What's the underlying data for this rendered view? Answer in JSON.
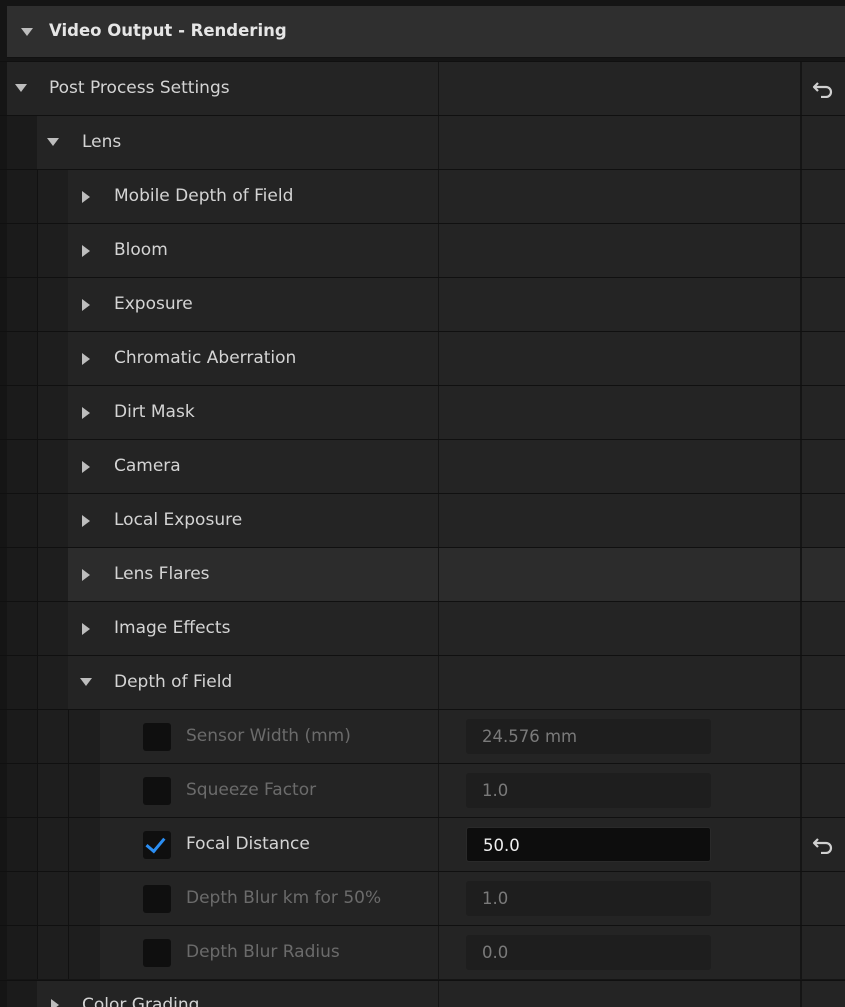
{
  "category": {
    "title": "Video Output - Rendering"
  },
  "post_process": {
    "label": "Post Process Settings",
    "reset_icon": "reset-arrow-icon"
  },
  "lens": {
    "label": "Lens"
  },
  "lens_sections": [
    {
      "label": "Mobile Depth of Field"
    },
    {
      "label": "Bloom"
    },
    {
      "label": "Exposure"
    },
    {
      "label": "Chromatic Aberration"
    },
    {
      "label": "Dirt Mask"
    },
    {
      "label": "Camera"
    },
    {
      "label": "Local Exposure"
    },
    {
      "label": "Lens Flares"
    },
    {
      "label": "Image Effects"
    }
  ],
  "dof": {
    "label": "Depth of Field",
    "properties": [
      {
        "label": "Sensor Width (mm)",
        "value": "24.576 mm",
        "checked": false
      },
      {
        "label": "Squeeze Factor",
        "value": "1.0",
        "checked": false
      },
      {
        "label": "Focal Distance",
        "value": "50.0",
        "checked": true
      },
      {
        "label": "Depth Blur km for 50%",
        "value": "1.0",
        "checked": false
      },
      {
        "label": "Depth Blur Radius",
        "value": "0.0",
        "checked": false
      }
    ]
  },
  "color_grading": {
    "label": "Color Grading"
  },
  "colors": {
    "accent": "#2b8ef3",
    "panel": "#242424",
    "header": "#2f2f2f"
  }
}
